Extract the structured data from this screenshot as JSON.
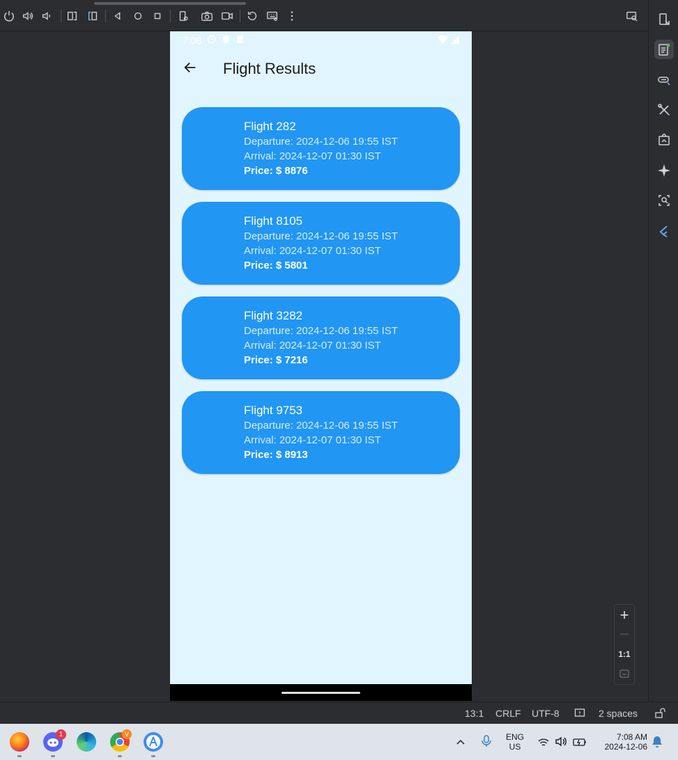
{
  "toolbar": {
    "icons": [
      "power-icon",
      "volume-up-icon",
      "volume-down-icon",
      "rotate-left-icon",
      "rotate-right-icon",
      "back-triangle-icon",
      "home-circle-icon",
      "overview-square-icon",
      "device-settings-icon",
      "camera-icon",
      "video-record-icon",
      "reset-icon",
      "keyboard-icon",
      "more-vert-icon",
      "device-mirror-icon"
    ]
  },
  "phone": {
    "status": {
      "time": "7:08"
    },
    "app_title": "Flight Results",
    "flights": [
      {
        "title": "Flight 282",
        "departure": "Departure: 2024-12-06 19:55 IST",
        "arrival": "Arrival: 2024-12-07 01:30 IST",
        "price": "Price: $ 8876"
      },
      {
        "title": "Flight 8105",
        "departure": "Departure: 2024-12-06 19:55 IST",
        "arrival": "Arrival: 2024-12-07 01:30 IST",
        "price": "Price: $ 5801"
      },
      {
        "title": "Flight 3282",
        "departure": "Departure: 2024-12-06 19:55 IST",
        "arrival": "Arrival: 2024-12-07 01:30 IST",
        "price": "Price: $ 7216"
      },
      {
        "title": "Flight 9753",
        "departure": "Departure: 2024-12-06 19:55 IST",
        "arrival": "Arrival: 2024-12-07 01:30 IST",
        "price": "Price: $ 8913"
      }
    ]
  },
  "zoom": {
    "plus": "+",
    "minus": "—",
    "one_to_one": "1:1"
  },
  "ide_status": {
    "position": "13:1",
    "line_ending": "CRLF",
    "encoding": "UTF-8",
    "indent": "2 spaces"
  },
  "taskbar": {
    "discord_badge": "1",
    "chrome_badge": "V",
    "lang_top": "ENG",
    "lang_bottom": "US",
    "time": "7:08 AM",
    "date": "2024-12-06"
  },
  "colors": {
    "card": "#2196f3",
    "phone_bg": "#e1f5fe",
    "ide_bg": "#2b2d30",
    "taskbar_bg": "#dfe3ea"
  }
}
